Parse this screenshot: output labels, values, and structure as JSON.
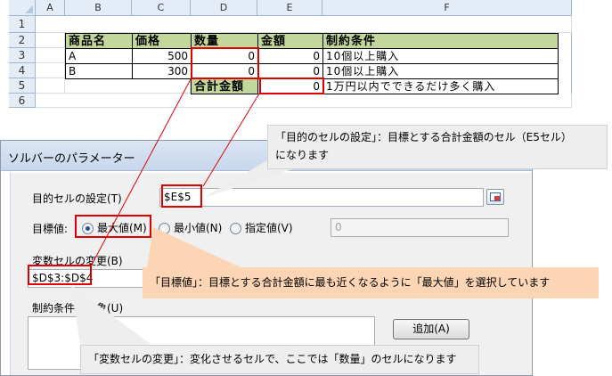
{
  "sheet": {
    "columns": [
      "A",
      "B",
      "C",
      "D",
      "E",
      "F"
    ],
    "rows": [
      "1",
      "2",
      "3",
      "4",
      "5",
      "6"
    ],
    "headers": [
      "商品名",
      "価格",
      "数量",
      "金額",
      "制約条件"
    ],
    "data": [
      {
        "name": "A",
        "price": "500",
        "qty": "0",
        "amount": "0",
        "constraint": "10個以上購入"
      },
      {
        "name": "B",
        "price": "300",
        "qty": "0",
        "amount": "0",
        "constraint": "10個以上購入"
      }
    ],
    "total_label": "合計金額",
    "total_value": "0",
    "total_constraint": "1万円以内でできるだけ多く購入"
  },
  "dialog": {
    "title": "ソルバーのパラメーター",
    "objective_label": "目的セルの設定(T)",
    "objective_value": "$E$5",
    "target_label": "目標値:",
    "radio_max": "最大値(M)",
    "radio_min": "最小値(N)",
    "radio_value": "指定値(V)",
    "value_field": "0",
    "changing_label": "変数セルの変更(B)",
    "changing_value": "$D$3:$D$4",
    "constraints_label": "制約条件の対象(U)",
    "add_button": "追加(A)"
  },
  "callouts": {
    "objective_line1": "「目的のセルの設定」：目標とする合計金額のセル（E5セル）",
    "objective_line2": "になります",
    "target": "「目標値」：目標とする合計金額に最も近くなるように「最大値」を選択しています",
    "changing": "「変数セルの変更」：変化させるセルで、ここでは「数量」のセルになります"
  },
  "colors": {
    "highlight_red": "#e00000",
    "header_green": "#c4d79b",
    "callout_orange": "#fcd5b4",
    "callout_grey": "#eeeeee"
  }
}
